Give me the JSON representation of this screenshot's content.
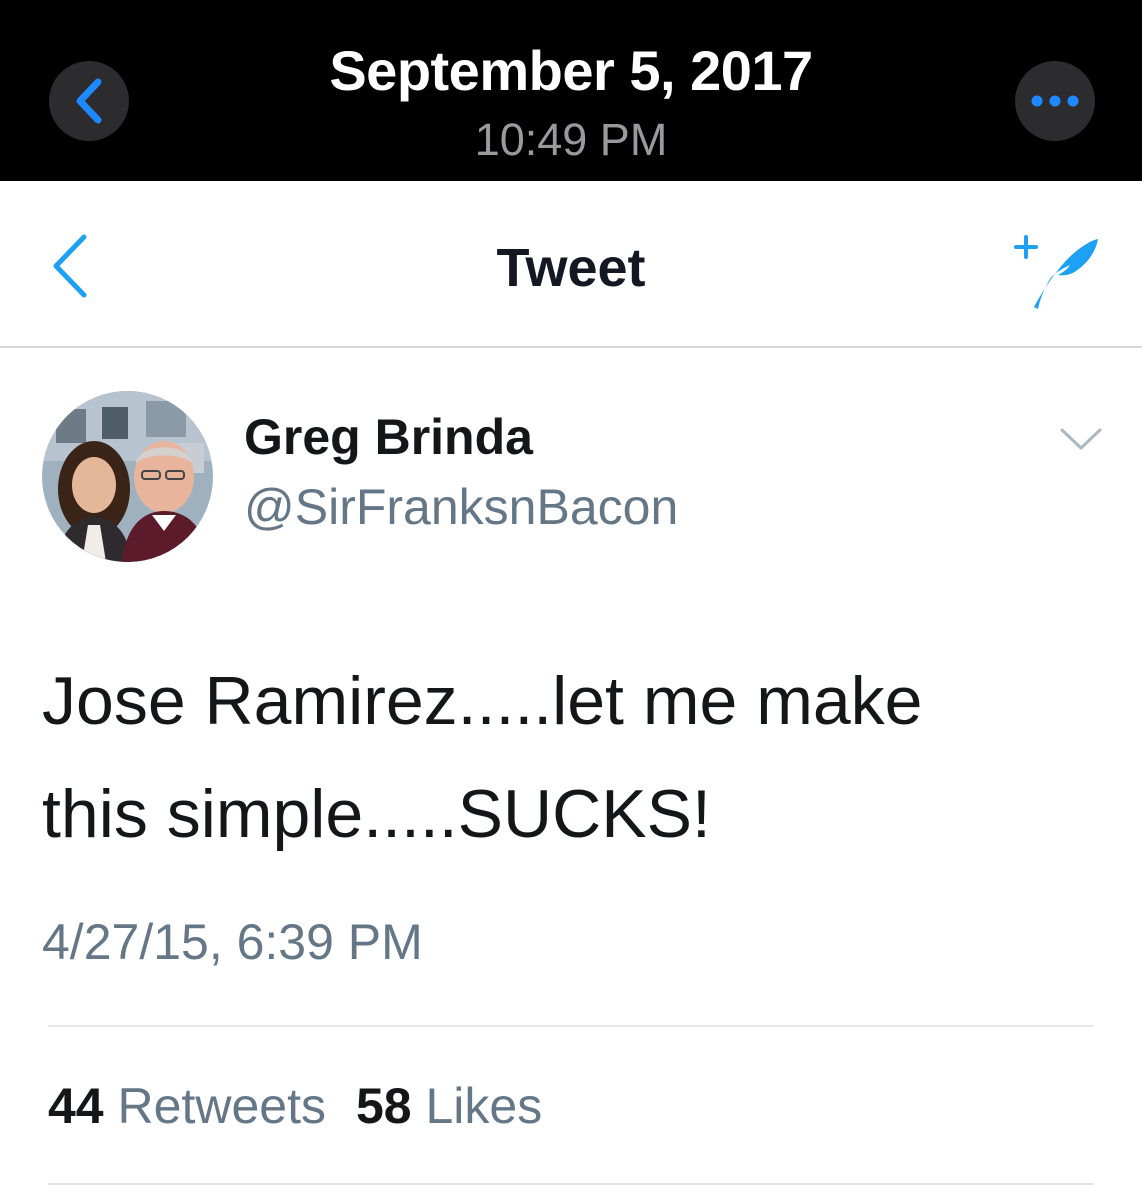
{
  "photo_viewer": {
    "date": "September 5, 2017",
    "time": "10:49 PM",
    "back_icon": "chevron-left-icon",
    "more_icon": "ellipsis-icon"
  },
  "nav": {
    "title": "Tweet",
    "back_icon": "chevron-left-icon",
    "compose_icon": "compose-tweet-icon"
  },
  "tweet": {
    "display_name": "Greg Brinda",
    "handle": "@SirFranksnBacon",
    "text_line1": "Jose Ramirez.....let me make",
    "text_line2": "this simple.....SUCKS!",
    "timestamp": "4/27/15, 6:39 PM",
    "retweets_count": "44",
    "retweets_label": "Retweets",
    "likes_count": "58",
    "likes_label": "Likes"
  },
  "colors": {
    "accent": "#1da1f2",
    "text_primary": "#14171a",
    "text_secondary": "#657786"
  }
}
